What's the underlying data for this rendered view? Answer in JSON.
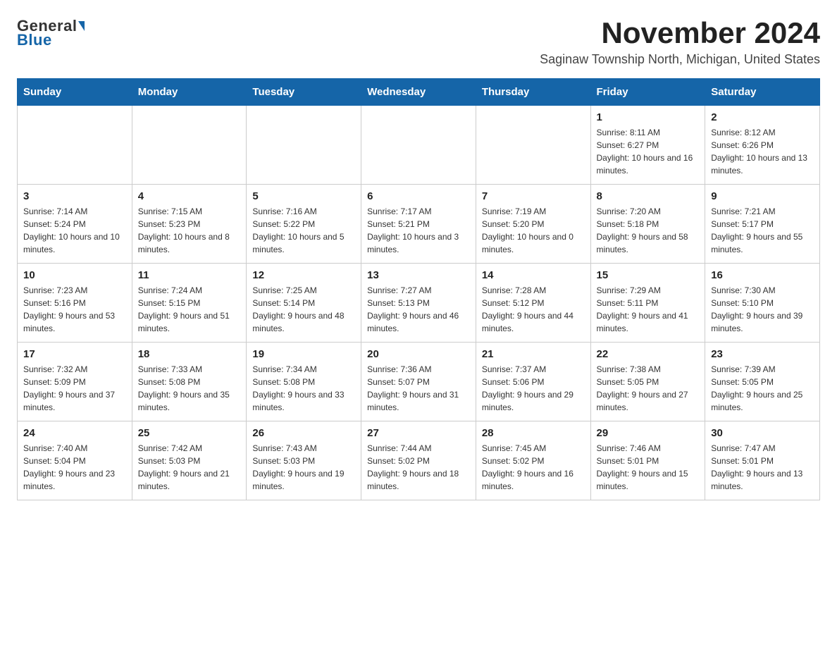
{
  "header": {
    "logo_general": "General",
    "logo_blue": "Blue",
    "month_year": "November 2024",
    "location": "Saginaw Township North, Michigan, United States"
  },
  "calendar": {
    "days_of_week": [
      "Sunday",
      "Monday",
      "Tuesday",
      "Wednesday",
      "Thursday",
      "Friday",
      "Saturday"
    ],
    "weeks": [
      [
        {
          "day": "",
          "info": ""
        },
        {
          "day": "",
          "info": ""
        },
        {
          "day": "",
          "info": ""
        },
        {
          "day": "",
          "info": ""
        },
        {
          "day": "",
          "info": ""
        },
        {
          "day": "1",
          "info": "Sunrise: 8:11 AM\nSunset: 6:27 PM\nDaylight: 10 hours and 16 minutes."
        },
        {
          "day": "2",
          "info": "Sunrise: 8:12 AM\nSunset: 6:26 PM\nDaylight: 10 hours and 13 minutes."
        }
      ],
      [
        {
          "day": "3",
          "info": "Sunrise: 7:14 AM\nSunset: 5:24 PM\nDaylight: 10 hours and 10 minutes."
        },
        {
          "day": "4",
          "info": "Sunrise: 7:15 AM\nSunset: 5:23 PM\nDaylight: 10 hours and 8 minutes."
        },
        {
          "day": "5",
          "info": "Sunrise: 7:16 AM\nSunset: 5:22 PM\nDaylight: 10 hours and 5 minutes."
        },
        {
          "day": "6",
          "info": "Sunrise: 7:17 AM\nSunset: 5:21 PM\nDaylight: 10 hours and 3 minutes."
        },
        {
          "day": "7",
          "info": "Sunrise: 7:19 AM\nSunset: 5:20 PM\nDaylight: 10 hours and 0 minutes."
        },
        {
          "day": "8",
          "info": "Sunrise: 7:20 AM\nSunset: 5:18 PM\nDaylight: 9 hours and 58 minutes."
        },
        {
          "day": "9",
          "info": "Sunrise: 7:21 AM\nSunset: 5:17 PM\nDaylight: 9 hours and 55 minutes."
        }
      ],
      [
        {
          "day": "10",
          "info": "Sunrise: 7:23 AM\nSunset: 5:16 PM\nDaylight: 9 hours and 53 minutes."
        },
        {
          "day": "11",
          "info": "Sunrise: 7:24 AM\nSunset: 5:15 PM\nDaylight: 9 hours and 51 minutes."
        },
        {
          "day": "12",
          "info": "Sunrise: 7:25 AM\nSunset: 5:14 PM\nDaylight: 9 hours and 48 minutes."
        },
        {
          "day": "13",
          "info": "Sunrise: 7:27 AM\nSunset: 5:13 PM\nDaylight: 9 hours and 46 minutes."
        },
        {
          "day": "14",
          "info": "Sunrise: 7:28 AM\nSunset: 5:12 PM\nDaylight: 9 hours and 44 minutes."
        },
        {
          "day": "15",
          "info": "Sunrise: 7:29 AM\nSunset: 5:11 PM\nDaylight: 9 hours and 41 minutes."
        },
        {
          "day": "16",
          "info": "Sunrise: 7:30 AM\nSunset: 5:10 PM\nDaylight: 9 hours and 39 minutes."
        }
      ],
      [
        {
          "day": "17",
          "info": "Sunrise: 7:32 AM\nSunset: 5:09 PM\nDaylight: 9 hours and 37 minutes."
        },
        {
          "day": "18",
          "info": "Sunrise: 7:33 AM\nSunset: 5:08 PM\nDaylight: 9 hours and 35 minutes."
        },
        {
          "day": "19",
          "info": "Sunrise: 7:34 AM\nSunset: 5:08 PM\nDaylight: 9 hours and 33 minutes."
        },
        {
          "day": "20",
          "info": "Sunrise: 7:36 AM\nSunset: 5:07 PM\nDaylight: 9 hours and 31 minutes."
        },
        {
          "day": "21",
          "info": "Sunrise: 7:37 AM\nSunset: 5:06 PM\nDaylight: 9 hours and 29 minutes."
        },
        {
          "day": "22",
          "info": "Sunrise: 7:38 AM\nSunset: 5:05 PM\nDaylight: 9 hours and 27 minutes."
        },
        {
          "day": "23",
          "info": "Sunrise: 7:39 AM\nSunset: 5:05 PM\nDaylight: 9 hours and 25 minutes."
        }
      ],
      [
        {
          "day": "24",
          "info": "Sunrise: 7:40 AM\nSunset: 5:04 PM\nDaylight: 9 hours and 23 minutes."
        },
        {
          "day": "25",
          "info": "Sunrise: 7:42 AM\nSunset: 5:03 PM\nDaylight: 9 hours and 21 minutes."
        },
        {
          "day": "26",
          "info": "Sunrise: 7:43 AM\nSunset: 5:03 PM\nDaylight: 9 hours and 19 minutes."
        },
        {
          "day": "27",
          "info": "Sunrise: 7:44 AM\nSunset: 5:02 PM\nDaylight: 9 hours and 18 minutes."
        },
        {
          "day": "28",
          "info": "Sunrise: 7:45 AM\nSunset: 5:02 PM\nDaylight: 9 hours and 16 minutes."
        },
        {
          "day": "29",
          "info": "Sunrise: 7:46 AM\nSunset: 5:01 PM\nDaylight: 9 hours and 15 minutes."
        },
        {
          "day": "30",
          "info": "Sunrise: 7:47 AM\nSunset: 5:01 PM\nDaylight: 9 hours and 13 minutes."
        }
      ]
    ]
  }
}
